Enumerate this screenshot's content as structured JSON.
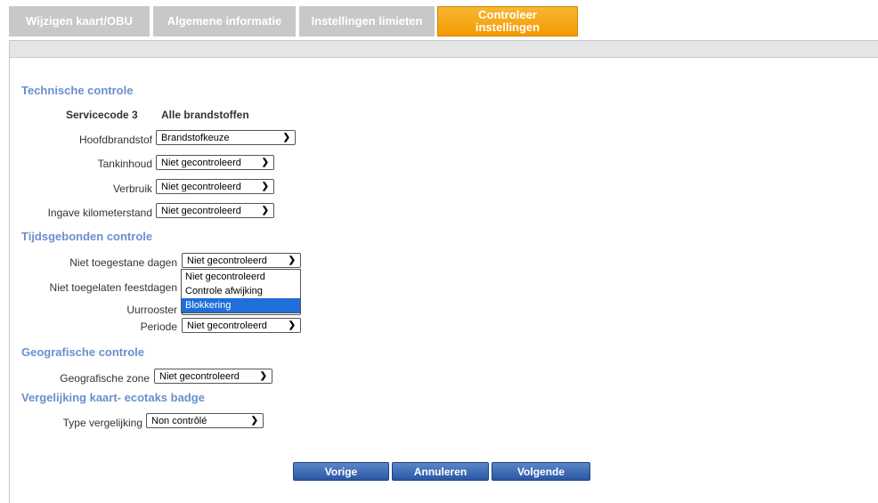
{
  "tabs": [
    {
      "label": "Wijzigen kaart/OBU"
    },
    {
      "label": "Algemene informatie"
    },
    {
      "label": "Instellingen limieten"
    },
    {
      "label": "Controleer instellingen"
    }
  ],
  "technische": {
    "title": "Technische controle",
    "servicecode_label": "Servicecode 3",
    "servicecode_value": "Alle brandstoffen",
    "hoofdbrandstof_label": "Hoofdbrandstof",
    "hoofdbrandstof_value": "Brandstofkeuze",
    "tankinhoud_label": "Tankinhoud",
    "tankinhoud_value": "Niet gecontroleerd",
    "verbruik_label": "Verbruik",
    "verbruik_value": "Niet gecontroleerd",
    "kilometerstand_label": "Ingave kilometerstand",
    "kilometerstand_value": "Niet gecontroleerd"
  },
  "tijd": {
    "title": "Tijdsgebonden controle",
    "dagen_label": "Niet toegestane dagen",
    "dagen_value": "Niet gecontroleerd",
    "feestdagen_label": "Niet toegelaten feestdagen",
    "uurrooster_label": "Uurrooster",
    "periode_label": "Periode",
    "periode_value": "Niet gecontroleerd",
    "dropdown_options": [
      "Niet gecontroleerd",
      "Controle afwijking",
      "Blokkering"
    ]
  },
  "geo": {
    "title": "Geografische controle",
    "zone_label": "Geografische zone",
    "zone_value": "Niet gecontroleerd"
  },
  "ecotaks": {
    "title": "Vergelijking kaart- ecotaks badge",
    "type_label": "Type vergelijking",
    "type_value": "Non contrôlé"
  },
  "buttons": {
    "prev": "Vorige",
    "cancel": "Annuleren",
    "next": "Volgende"
  },
  "colors": {
    "tab_inactive": "#c8c8c8",
    "tab_active": "#f39a00",
    "section_title": "#6a8fce",
    "button": "#2c57a4",
    "highlight": "#1e6fd9"
  }
}
